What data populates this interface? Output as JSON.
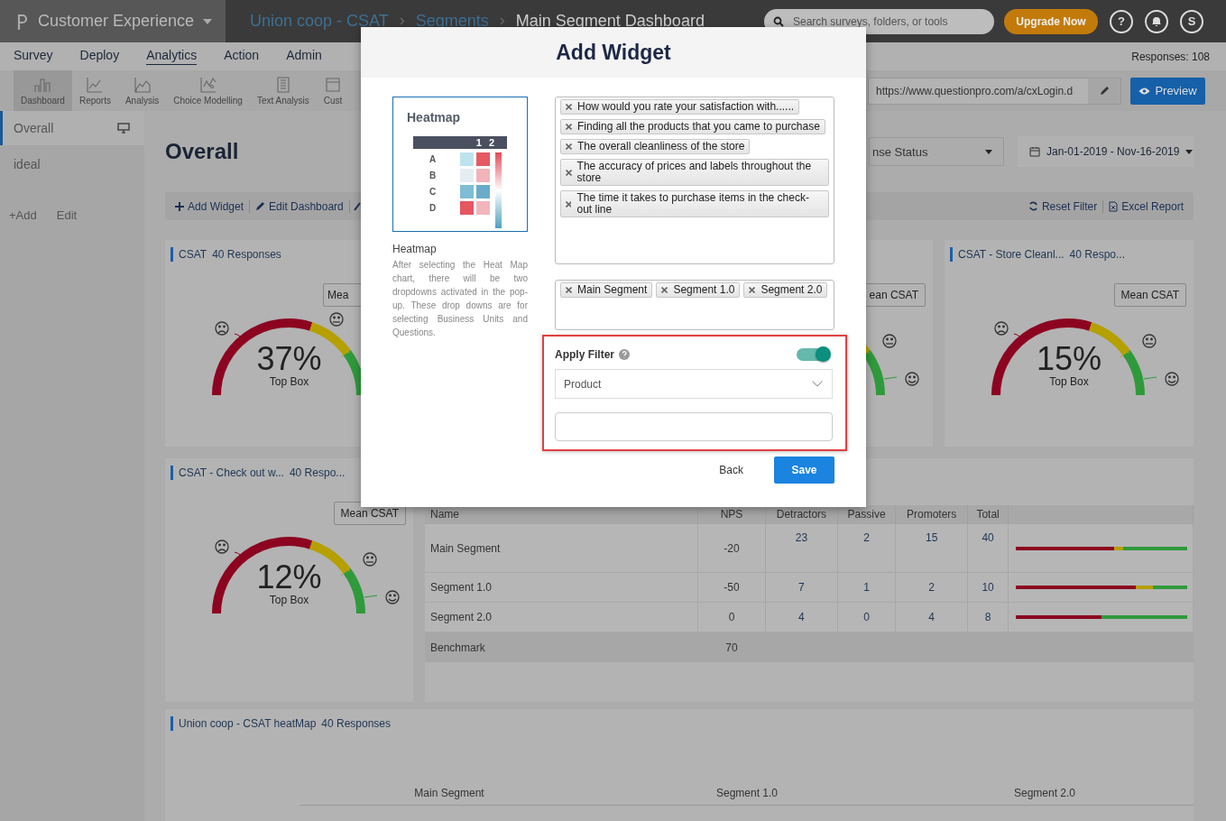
{
  "topbar": {
    "product": "Customer Experience",
    "breadcrumbs": [
      {
        "label": "Union coop - CSAT",
        "link": true
      },
      {
        "label": "Segments",
        "link": true
      },
      {
        "label": "Main Segment Dashboard",
        "link": false
      }
    ],
    "search": {
      "placeholder": "Search surveys, folders, or tools"
    },
    "upgrade": "Upgrade Now",
    "help": "?",
    "user_initial": "S"
  },
  "menu": {
    "items": [
      {
        "label": "Survey",
        "selected": false
      },
      {
        "label": "Deploy",
        "selected": false
      },
      {
        "label": "Analytics",
        "selected": true
      },
      {
        "label": "Action",
        "selected": false
      },
      {
        "label": "Admin",
        "selected": false
      }
    ],
    "responses": "Responses: 108"
  },
  "toolbar": {
    "items": [
      {
        "label": "Dashboard",
        "kind": "bars",
        "selected": true
      },
      {
        "label": "Reports",
        "kind": "line",
        "selected": false
      },
      {
        "label": "Analysis",
        "kind": "area",
        "selected": false
      },
      {
        "label": "Choice Modelling",
        "kind": "scatter",
        "selected": false
      },
      {
        "label": "Text Analysis",
        "kind": "book",
        "selected": false
      },
      {
        "label": "Cust",
        "kind": "panel",
        "selected": false
      }
    ],
    "url": "https://www.questionpro.com/a/cxLogin.d",
    "preview": "Preview"
  },
  "sidebar": {
    "items": [
      {
        "label": "Overall",
        "selected": true
      },
      {
        "label": "ideal",
        "selected": false
      }
    ],
    "add": "+Add",
    "edit": "Edit"
  },
  "dashboard": {
    "title": "Overall",
    "status_filter": "nse Status",
    "date_range": "Jan-01-2019 - Nov-16-2019",
    "actions": [
      {
        "label": "Add Widget",
        "kind": "plus"
      },
      {
        "label": "Edit Dashboard",
        "kind": "pencil"
      }
    ],
    "reset": "Reset Filter",
    "excel": "Excel Report"
  },
  "gauge_cards": [
    {
      "title": "CSAT",
      "responses": "40 Responses",
      "mean": "Mea",
      "value": "37%",
      "label": "Top Box"
    },
    {
      "mean": "ean CSAT"
    },
    {
      "title": "CSAT - Store Cleanl...",
      "responses": "40 Respo...",
      "mean": "Mean CSAT",
      "value": "15%",
      "label": "Top Box"
    },
    {
      "title": "CSAT - Check out w...",
      "responses": "40 Respo...",
      "mean": "Mean CSAT",
      "value": "12%",
      "label": "Top Box"
    }
  ],
  "segment_table": {
    "columns": [
      "Name",
      "NPS",
      "Detractors",
      "Passive",
      "Promoters",
      "Total"
    ],
    "rows": [
      {
        "name": "Main Segment",
        "nps": "-20",
        "detractors": "23",
        "passive": "2",
        "promoters": "15",
        "total": "40"
      },
      {
        "name": "Segment 1.0",
        "nps": "-50",
        "detractors": "7",
        "passive": "1",
        "promoters": "2",
        "total": "10"
      },
      {
        "name": "Segment 2.0",
        "nps": "0",
        "detractors": "4",
        "passive": "0",
        "promoters": "4",
        "total": "8"
      }
    ],
    "benchmark": {
      "name": "Benchmark",
      "nps": "70"
    }
  },
  "heatmap_card": {
    "title": "Union coop - CSAT heatMap",
    "responses": "40 Responses",
    "categories": [
      "Main Segment",
      "Segment 1.0",
      "Segment 2.0"
    ]
  },
  "modal": {
    "title": "Add Widget",
    "preview": {
      "title": "Heatmap",
      "columns": [
        "1",
        "2"
      ],
      "rows": [
        "A",
        "B",
        "C",
        "D"
      ]
    },
    "chart_name": "Heatmap",
    "description": "After selecting the Heat Map chart, there will be two dropdowns activated in the pop-up. These drop downs are for selecting Business Units and Questions.",
    "questions": [
      "How would you rate your satisfaction with......",
      "Finding all the products that you came to purchase",
      "The overall cleanliness of the store",
      "The accuracy of prices and labels throughout the store",
      "The time it takes to purchase items in the check-out line"
    ],
    "segments": [
      "Main Segment",
      "Segment 1.0",
      "Segment 2.0"
    ],
    "filter": {
      "label": "Apply Filter",
      "on": true,
      "select": "Product"
    },
    "back": "Back",
    "save": "Save"
  }
}
